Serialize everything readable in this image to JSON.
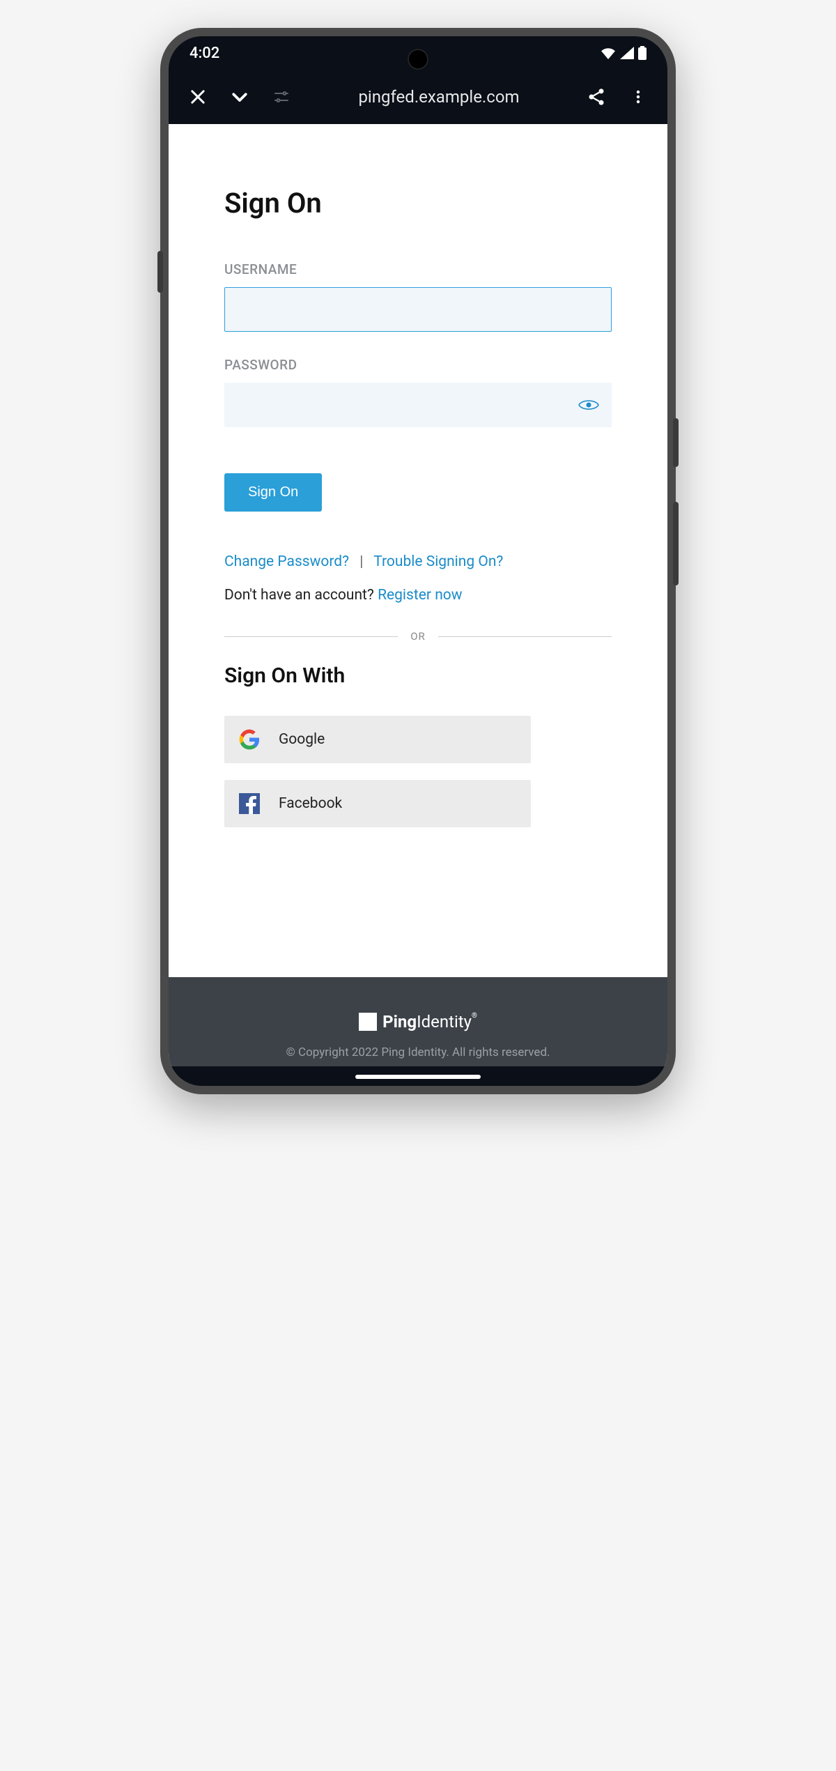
{
  "status": {
    "time": "4:02"
  },
  "browser": {
    "url": "pingfed.example.com"
  },
  "main": {
    "title": "Sign On",
    "username_label": "USERNAME",
    "password_label": "PASSWORD",
    "signon_button": "Sign On",
    "change_password": "Change Password?",
    "trouble": "Trouble Signing On?",
    "no_account": "Don't have an account? ",
    "register": "Register now",
    "or": "OR",
    "sign_on_with": "Sign On With",
    "google": "Google",
    "facebook": "Facebook"
  },
  "footer": {
    "brand": "PingIdentity",
    "copyright": "© Copyright 2022 Ping Identity. All rights reserved."
  }
}
